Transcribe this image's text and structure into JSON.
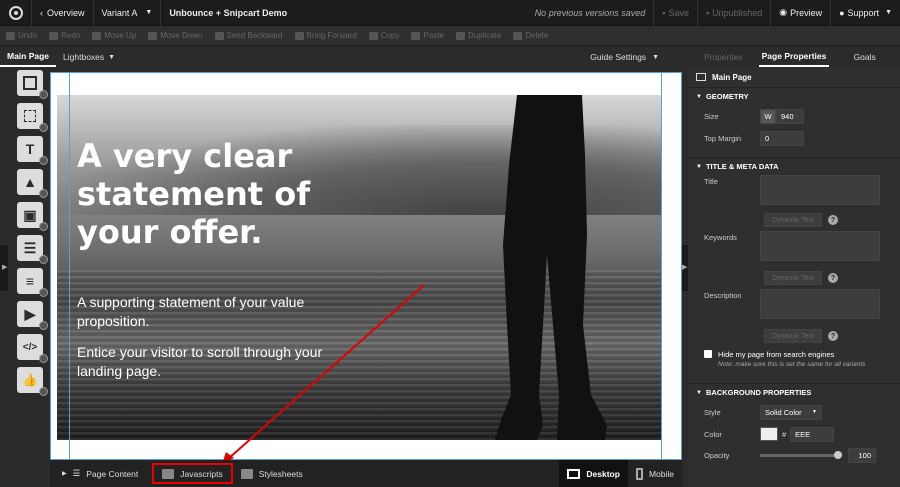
{
  "topbar": {
    "back_label": "Overview",
    "variant_label": "Variant A",
    "page_title": "Unbounce + Snipcart Demo",
    "versions_status": "No previous versions saved",
    "save_label": "Save",
    "unpublished_label": "Unpublished",
    "preview_label": "Preview",
    "support_label": "Support"
  },
  "toolbar": {
    "undo": "Undo",
    "redo": "Redo",
    "move_up": "Move Up",
    "move_down": "Move Down",
    "send_backward": "Send Backward",
    "bring_forward": "Bring Forward",
    "copy": "Copy",
    "paste": "Paste",
    "duplicate": "Duplicate",
    "delete": "Delete"
  },
  "tabs": {
    "main_page": "Main Page",
    "lightboxes": "Lightboxes",
    "guide_settings": "Guide Settings"
  },
  "hero": {
    "headline": "A very clear statement of your offer.",
    "supporting": "A supporting statement of your value proposition.",
    "entice": "Entice your visitor to scroll through your landing page."
  },
  "bottombar": {
    "page_content": "Page Content",
    "javascripts": "Javascripts",
    "stylesheets": "Stylesheets",
    "desktop": "Desktop",
    "mobile": "Mobile"
  },
  "panel": {
    "tabs": [
      "Properties",
      "Page Properties",
      "Goals"
    ],
    "page_name": "Main Page",
    "geometry": {
      "heading": "GEOMETRY",
      "size_label": "Size",
      "w_label": "W",
      "width": "940",
      "top_margin_label": "Top Margin",
      "top_margin": "0"
    },
    "meta": {
      "heading": "TITLE & META DATA",
      "title_label": "Title",
      "keywords_label": "Keywords",
      "description_label": "Description",
      "dynamic_text": "Dynamic Text",
      "help": "?",
      "hide_label": "Hide my page from search engines",
      "hide_note": "Note: make sure this is set the same for all variants"
    },
    "background": {
      "heading": "BACKGROUND PROPERTIES",
      "style_label": "Style",
      "style_value": "Solid Color",
      "color_label": "Color",
      "hash": "#",
      "color_value": "EEE",
      "opacity_label": "Opacity",
      "opacity_value": "100"
    }
  },
  "colors": {
    "annotation": "#e00000",
    "guide": "#5aa0d8"
  }
}
